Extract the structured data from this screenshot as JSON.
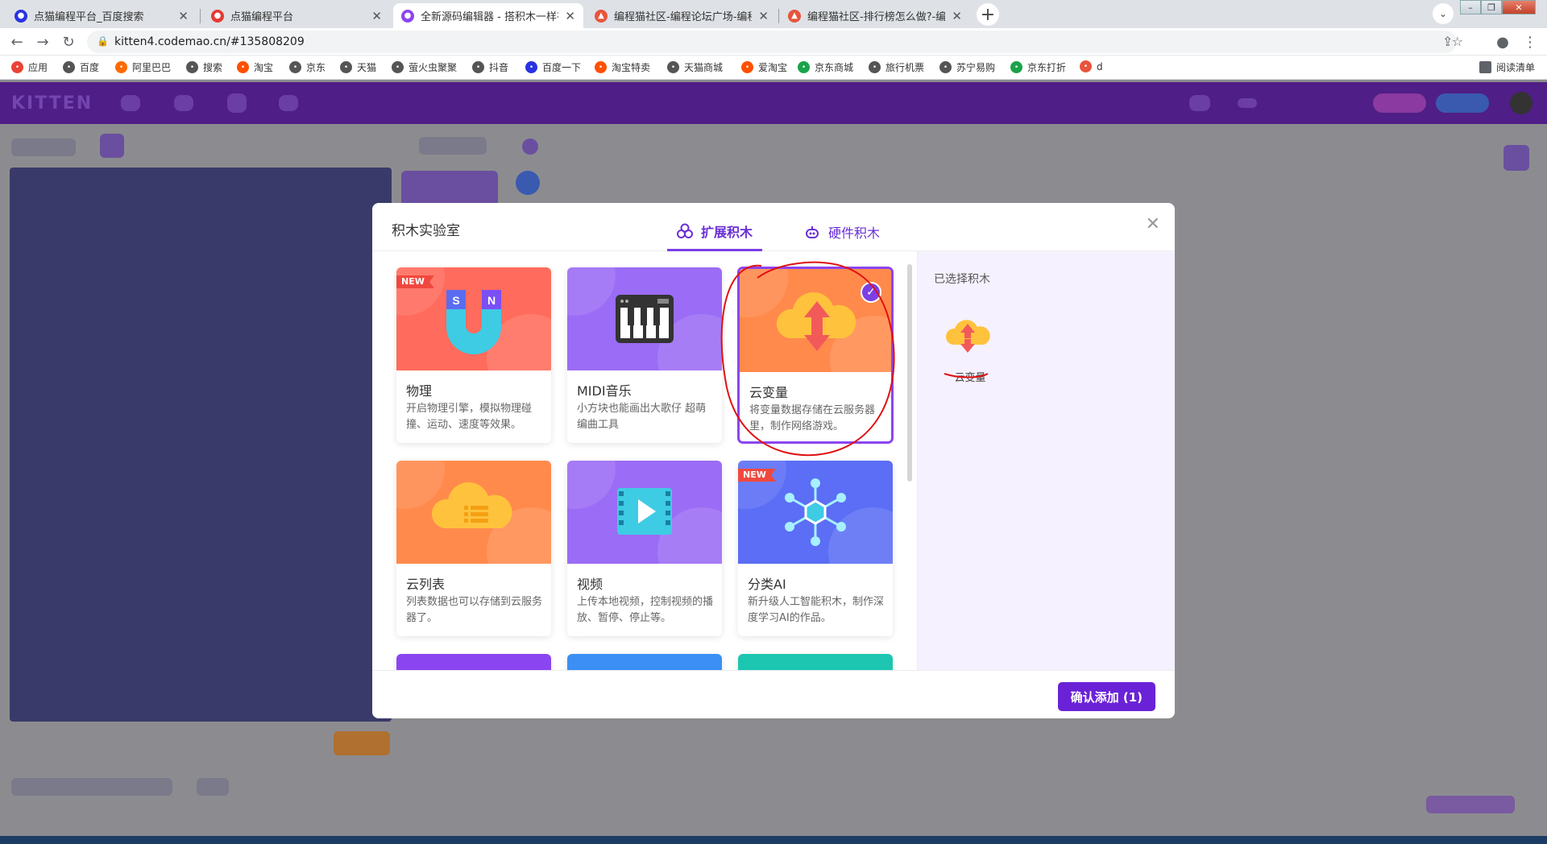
{
  "browser": {
    "tabs": [
      {
        "title": "点猫编程平台_百度搜索",
        "favicon": "baidu-paw-icon",
        "color": "#2932e1"
      },
      {
        "title": "点猫编程平台",
        "favicon": "red-circle-icon",
        "color": "#e53935"
      },
      {
        "title": "全新源码编辑器 - 搭积木一样有趣",
        "favicon": "codemao-icon",
        "color": "#8b45f0"
      },
      {
        "title": "编程猫社区-编程论坛广场-编程学",
        "favicon": "codemao-community-icon",
        "color": "#e8543c"
      },
      {
        "title": "编程猫社区-排行榜怎么做?-编程",
        "favicon": "codemao-community-icon",
        "color": "#e8543c"
      }
    ],
    "active_tab_index": 2,
    "url": "kitten4.codemao.cn/#135808209",
    "bookmarks": [
      {
        "label": "应用",
        "icon": "apps-grid-icon",
        "color": "#ea4335"
      },
      {
        "label": "百度",
        "icon": "globe-icon",
        "color": "#555555"
      },
      {
        "label": "阿里巴巴",
        "icon": "alibaba-icon",
        "color": "#ff6a00"
      },
      {
        "label": "搜索",
        "icon": "globe-icon",
        "color": "#555555"
      },
      {
        "label": "淘宝",
        "icon": "taobao-icon",
        "color": "#ff5000"
      },
      {
        "label": "京东",
        "icon": "globe-icon",
        "color": "#555555"
      },
      {
        "label": "天猫",
        "icon": "globe-icon",
        "color": "#555555"
      },
      {
        "label": "萤火虫聚聚",
        "icon": "globe-icon",
        "color": "#555555"
      },
      {
        "label": "抖音",
        "icon": "globe-icon",
        "color": "#555555"
      },
      {
        "label": "百度一下",
        "icon": "baidu-paw-icon",
        "color": "#2932e1"
      },
      {
        "label": "淘宝特卖",
        "icon": "taobao-icon",
        "color": "#ff5000"
      },
      {
        "label": "天猫商城",
        "icon": "globe-icon",
        "color": "#555555"
      },
      {
        "label": "爱淘宝",
        "icon": "taobao-icon",
        "color": "#ff5000"
      },
      {
        "label": "京东商城",
        "icon": "jd-icon",
        "color": "#1aa34a"
      },
      {
        "label": "旅行机票",
        "icon": "globe-icon",
        "color": "#555555"
      },
      {
        "label": "苏宁易购",
        "icon": "globe-icon",
        "color": "#555555"
      },
      {
        "label": "京东打折",
        "icon": "jd-icon",
        "color": "#1aa34a"
      },
      {
        "label": "d",
        "icon": "codemao-community-icon",
        "color": "#e8543c"
      }
    ],
    "reading_list": "阅读清单"
  },
  "app": {
    "logo": "KITTEN"
  },
  "modal": {
    "title": "积木实验室",
    "tabs": [
      {
        "label": "扩展积木",
        "icon": "extension-blocks-icon",
        "active": true
      },
      {
        "label": "硬件积木",
        "icon": "robot-icon",
        "active": false
      }
    ],
    "cards": [
      {
        "name": "物理",
        "desc": "开启物理引擎，模拟物理碰撞、运动、速度等效果。",
        "is_new": true,
        "new_label": "NEW",
        "selected": false,
        "icon": "magnet-icon",
        "bg": "#ff6b5c"
      },
      {
        "name": "MIDI音乐",
        "desc": "小方块也能画出大歌仔 超萌编曲工具",
        "is_new": false,
        "selected": false,
        "icon": "piano-icon",
        "bg": "#9b6cf5"
      },
      {
        "name": "云变量",
        "desc": "将变量数据存储在云服务器里，制作网络游戏。",
        "is_new": false,
        "selected": true,
        "icon": "cloud-variable-icon",
        "bg": "#ff8a4c"
      },
      {
        "name": "云列表",
        "desc": "列表数据也可以存储到云服务器了。",
        "is_new": false,
        "selected": false,
        "icon": "cloud-list-icon",
        "bg": "#ff8a4c"
      },
      {
        "name": "视频",
        "desc": "上传本地视频，控制视频的播放、暂停、停止等。",
        "is_new": false,
        "selected": false,
        "icon": "video-icon",
        "bg": "#9b6cf5"
      },
      {
        "name": "分类AI",
        "desc": "新升级人工智能积木，制作深度学习AI的作品。",
        "is_new": true,
        "new_label": "NEW",
        "selected": false,
        "icon": "ai-network-icon",
        "bg": "#5b6ef5"
      }
    ],
    "partial_cards_colors": [
      "#8b45f0",
      "#3b8ff5",
      "#1dc6b0"
    ],
    "selected_panel": {
      "title": "已选择积木",
      "items": [
        {
          "label": "云变量",
          "icon": "cloud-variable-icon"
        }
      ]
    },
    "confirm_label": "确认添加 (1)"
  }
}
